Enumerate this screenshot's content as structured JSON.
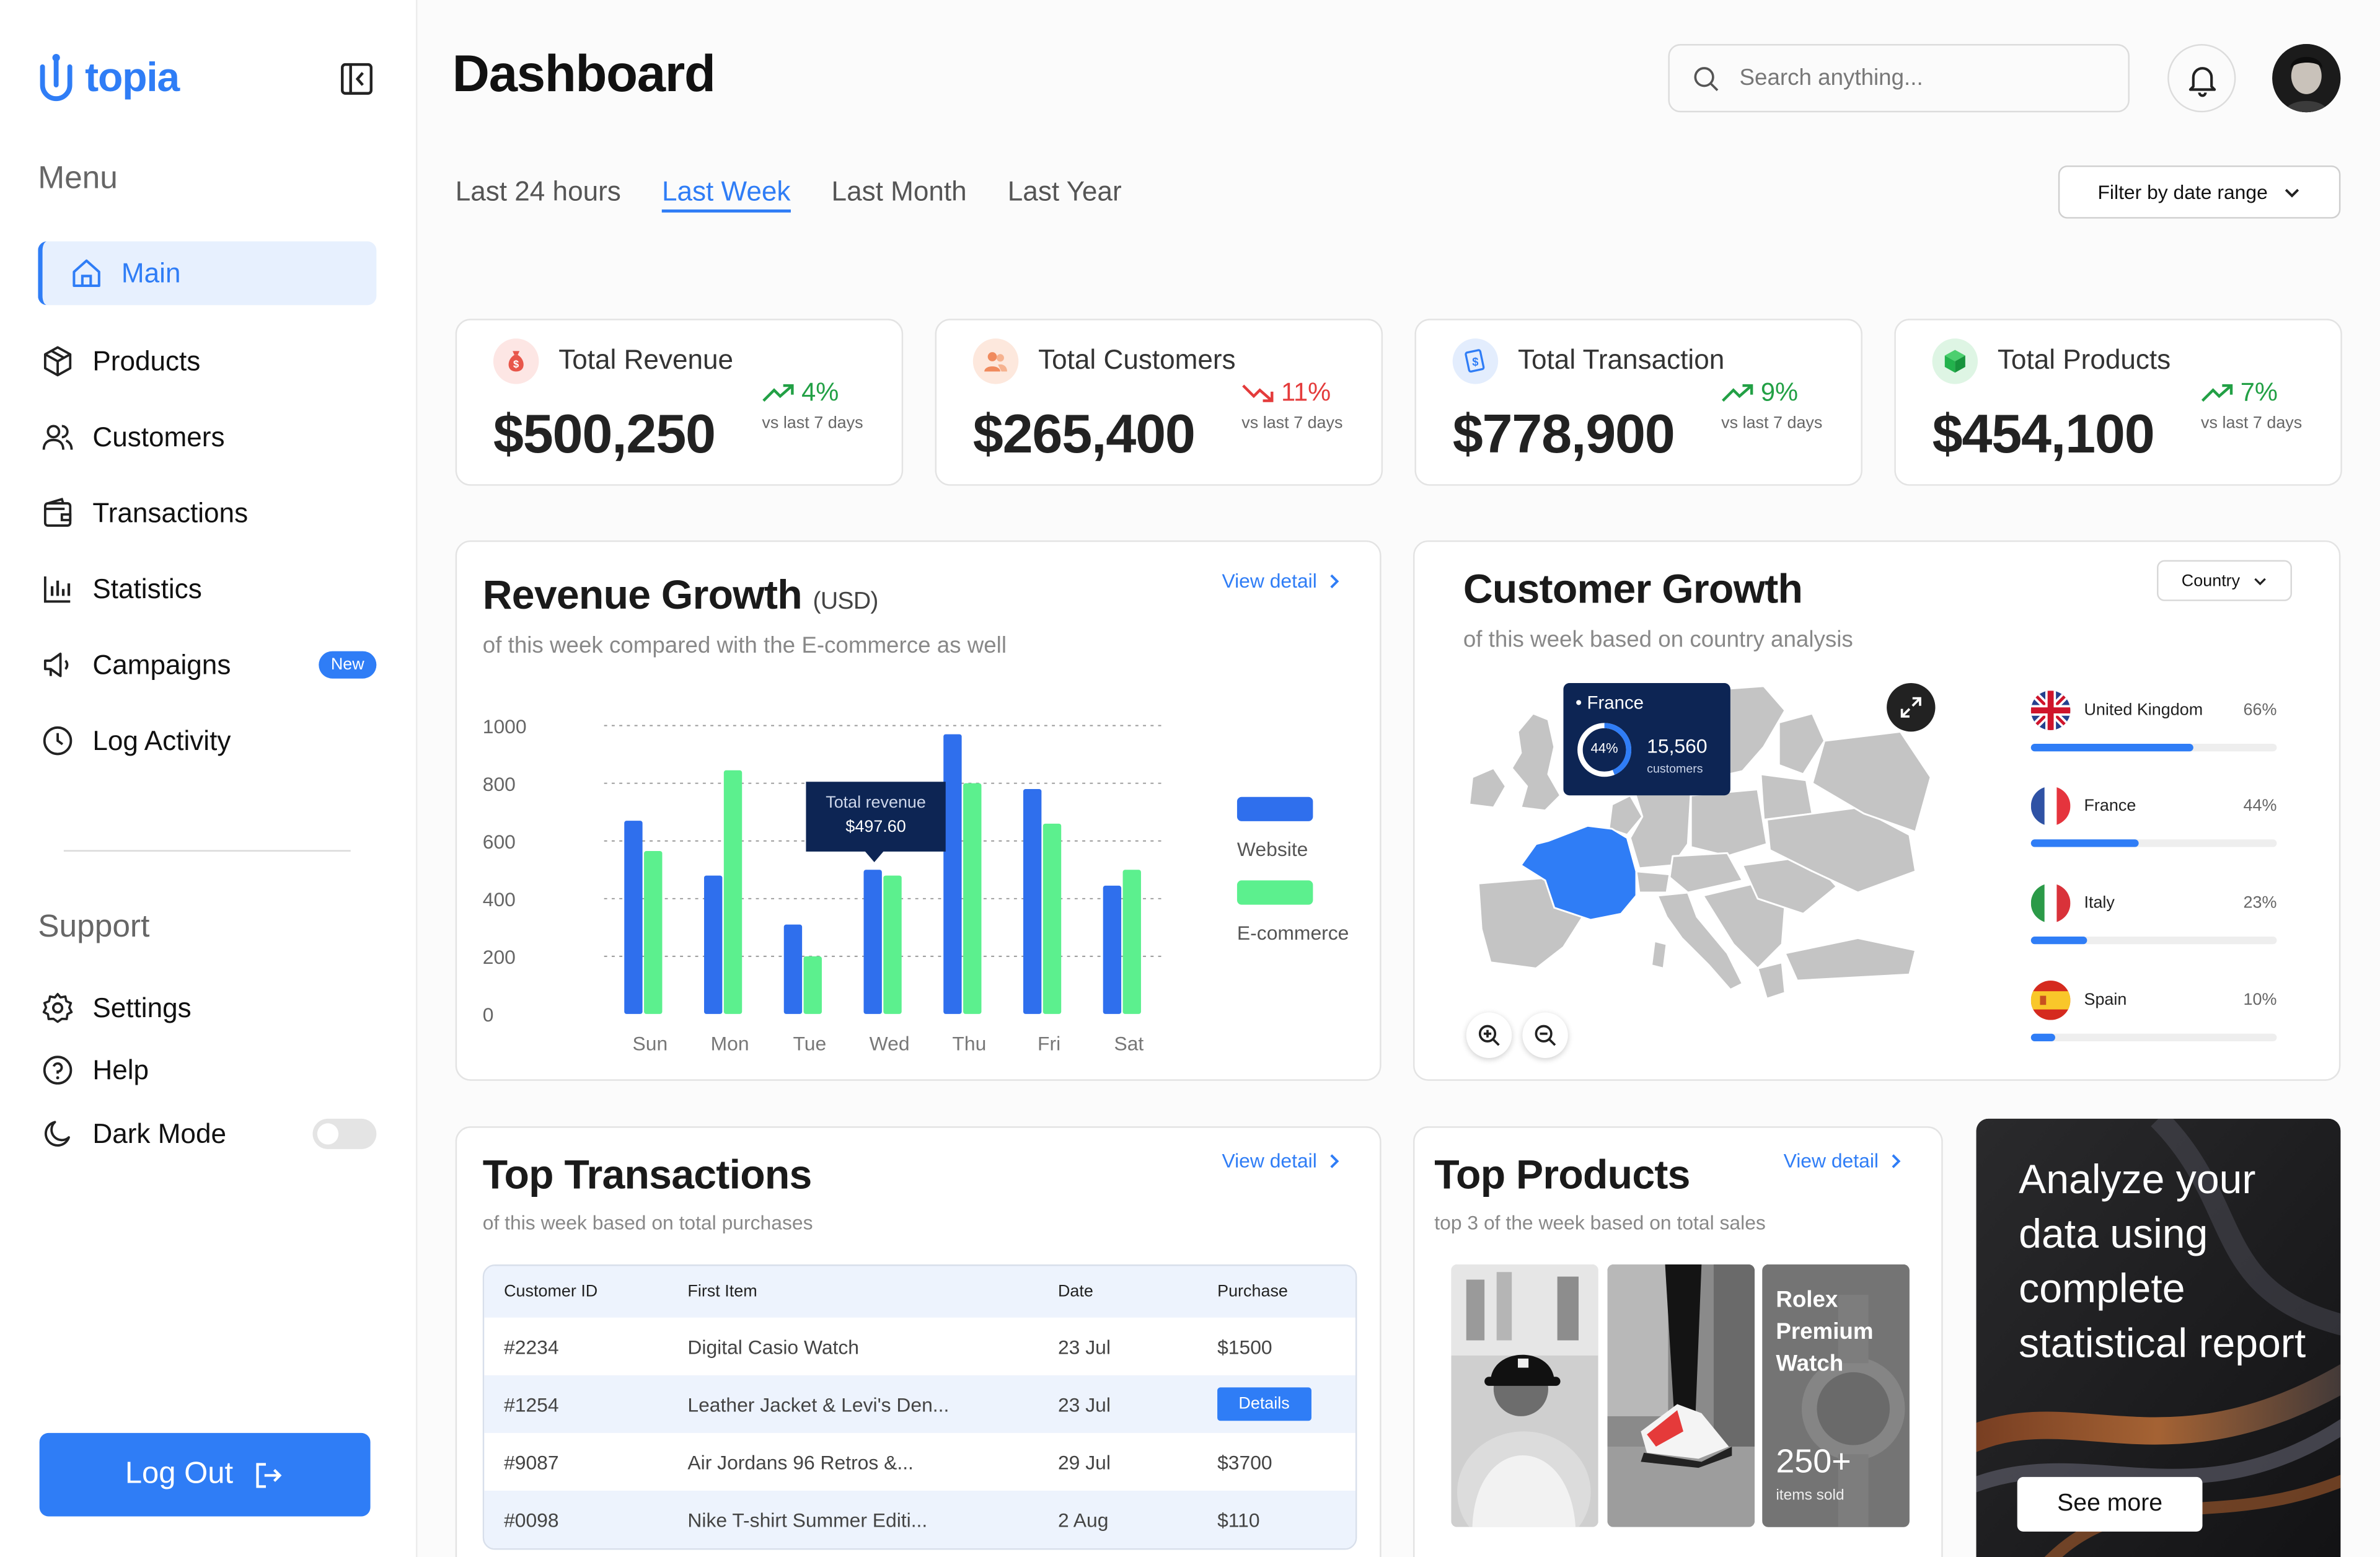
{
  "app": {
    "logo_text": "topia",
    "page_title": "Dashboard"
  },
  "sidebar": {
    "menu_title": "Menu",
    "items": [
      {
        "label": "Main",
        "icon": "home-icon"
      },
      {
        "label": "Products",
        "icon": "box-icon"
      },
      {
        "label": "Customers",
        "icon": "users-icon"
      },
      {
        "label": "Transactions",
        "icon": "wallet-icon"
      },
      {
        "label": "Statistics",
        "icon": "bar-chart-icon"
      },
      {
        "label": "Campaigns",
        "icon": "megaphone-icon",
        "badge": "New"
      },
      {
        "label": "Log Activity",
        "icon": "clock-icon"
      }
    ],
    "support_title": "Support",
    "support_items": [
      {
        "label": "Settings",
        "icon": "gear-icon"
      },
      {
        "label": "Help",
        "icon": "help-icon"
      },
      {
        "label": "Dark Mode",
        "icon": "moon-icon",
        "toggle": false
      }
    ],
    "logout_label": "Log Out"
  },
  "header": {
    "search_placeholder": "Search anything...",
    "tabs": [
      "Last 24 hours",
      "Last Week",
      "Last Month",
      "Last Year"
    ],
    "active_tab": "Last Week",
    "filter_label": "Filter by date range"
  },
  "stats": [
    {
      "label": "Total Revenue",
      "value": "$500,250",
      "trend": "4%",
      "direction": "up",
      "sub": "vs last 7 days",
      "color": "#e8564a"
    },
    {
      "label": "Total Customers",
      "value": "$265,400",
      "trend": "11%",
      "direction": "down",
      "sub": "vs last 7 days",
      "color": "#f08a5d"
    },
    {
      "label": "Total Transaction",
      "value": "$778,900",
      "trend": "9%",
      "direction": "up",
      "sub": "vs last 7 days",
      "color": "#2f7df6"
    },
    {
      "label": "Total Products",
      "value": "$454,100",
      "trend": "7%",
      "direction": "up",
      "sub": "vs last 7 days",
      "color": "#22b24c"
    }
  ],
  "revenue": {
    "title": "Revenue Growth",
    "unit": "(USD)",
    "subtitle": "of this week compared with the E-commerce as well",
    "view_detail": "View detail",
    "tooltip_label": "Total revenue",
    "tooltip_value": "$497.60"
  },
  "chart_data": {
    "type": "bar",
    "categories": [
      "Sun",
      "Mon",
      "Tue",
      "Wed",
      "Thu",
      "Fri",
      "Sat"
    ],
    "series": [
      {
        "name": "Website",
        "color": "#2f6fed",
        "values": [
          670,
          480,
          310,
          500,
          970,
          780,
          445
        ]
      },
      {
        "name": "E-commerce",
        "color": "#5cf08e",
        "values": [
          565,
          845,
          200,
          480,
          800,
          660,
          500
        ]
      }
    ],
    "yticks": [
      0,
      200,
      400,
      600,
      800,
      1000
    ],
    "ylim": [
      0,
      1000
    ],
    "grid": true,
    "legend": "right"
  },
  "customer_growth": {
    "title": "Customer Growth",
    "subtitle": "of this week based on country analysis",
    "dropdown": "Country",
    "popup_country": "France",
    "popup_pct": "44%",
    "popup_count": "15,560",
    "popup_unit": "customers",
    "countries": [
      {
        "name": "United Kingdom",
        "pct": "66%",
        "value": 66
      },
      {
        "name": "France",
        "pct": "44%",
        "value": 44
      },
      {
        "name": "Italy",
        "pct": "23%",
        "value": 23
      },
      {
        "name": "Spain",
        "pct": "10%",
        "value": 10
      }
    ]
  },
  "transactions": {
    "title": "Top Transactions",
    "subtitle": "of this week based on total purchases",
    "view_detail": "View detail",
    "columns": [
      "Customer ID",
      "First Item",
      "Date",
      "Purchase"
    ],
    "rows": [
      {
        "id": "#2234",
        "item": "Digital Casio Watch",
        "date": "23 Jul",
        "purchase": "$1500"
      },
      {
        "id": "#1254",
        "item": "Leather Jacket & Levi's Den...",
        "date": "23 Jul",
        "purchase": "Details"
      },
      {
        "id": "#9087",
        "item": "Air Jordans 96 Retros &...",
        "date": "29 Jul",
        "purchase": "$3700"
      },
      {
        "id": "#0098",
        "item": "Nike T-shirt Summer Editi...",
        "date": "2 Aug",
        "purchase": "$110"
      }
    ]
  },
  "products": {
    "title": "Top Products",
    "subtitle": "top 3 of the week based on total sales",
    "view_detail": "View detail",
    "featured_name": "Rolex Premium Watch",
    "featured_count": "250+",
    "featured_unit": "items sold"
  },
  "promo": {
    "text": "Analyze your data using complete statistical report",
    "button": "See more"
  },
  "colors": {
    "accent": "#2f7df6",
    "success": "#22a045",
    "danger": "#e43b3b",
    "ecommerce": "#5cf08e"
  }
}
